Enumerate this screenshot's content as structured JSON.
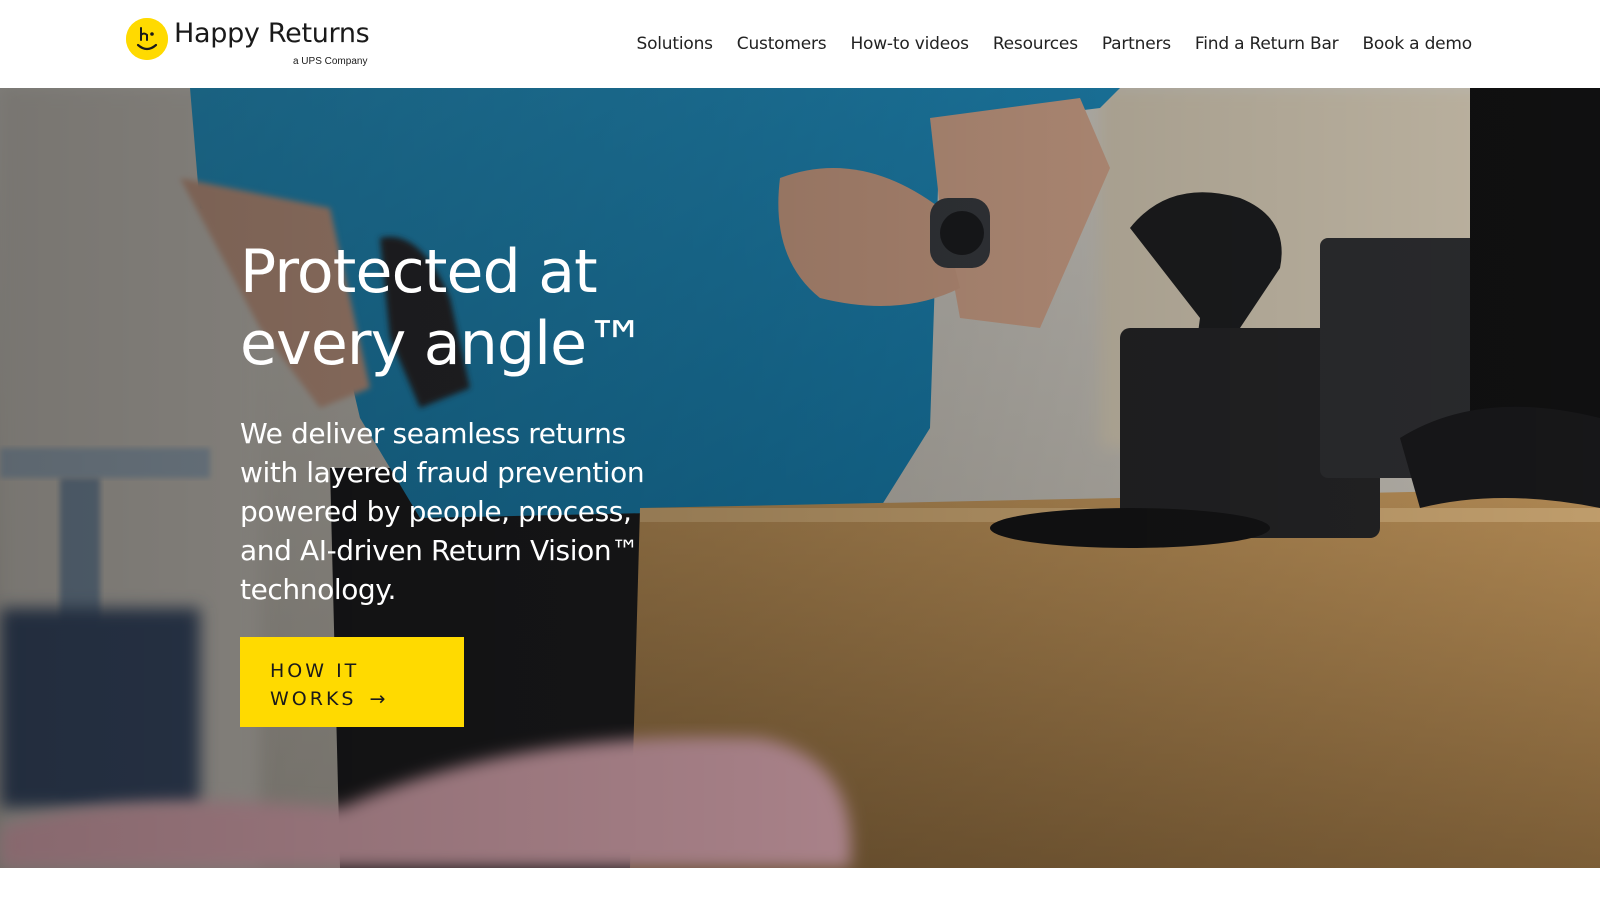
{
  "brand": {
    "name": "Happy Returns",
    "tagline": "a UPS Company",
    "accent_color": "#FFDA00",
    "logo_icon": "smiley-h-icon"
  },
  "nav": {
    "items": [
      {
        "label": "Solutions"
      },
      {
        "label": "Customers"
      },
      {
        "label": "How-to videos"
      },
      {
        "label": "Resources"
      },
      {
        "label": "Partners"
      },
      {
        "label": "Find a Return Bar"
      },
      {
        "label": "Book a demo"
      }
    ]
  },
  "hero": {
    "title_line1": "Protected at",
    "title_line2": "every angle™",
    "subtitle": "We deliver seamless returns with layered fraud prevention powered by people, process, and AI-driven Return Vision™ technology.",
    "cta_label": "HOW IT WORKS",
    "cta_arrow": "→",
    "background_image": "store-clerk-scanning-return-photo"
  }
}
